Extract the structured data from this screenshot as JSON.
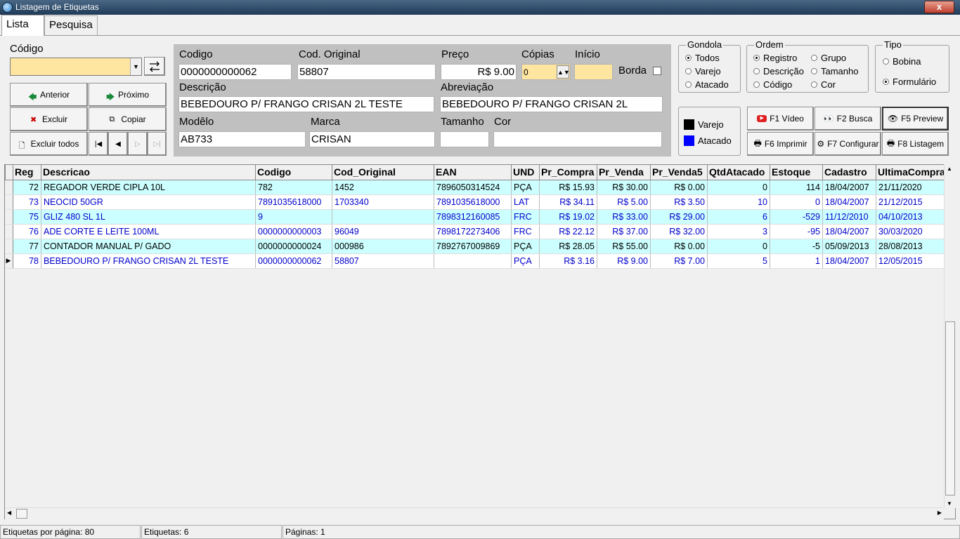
{
  "window": {
    "title": "Listagem de Etiquetas",
    "close": "x"
  },
  "tabs": [
    {
      "label": "Lista"
    },
    {
      "label": "Pesquisa"
    }
  ],
  "left": {
    "codigo_label": "Código",
    "codigo_value": "",
    "anterior": "Anterior",
    "proximo": "Próximo",
    "excluir": "Excluir",
    "copiar": "Copiar",
    "excluir_todos": "Excluir todos"
  },
  "form": {
    "codigo_label": "Codigo",
    "codigo_value": "0000000000062",
    "cod_original_label": "Cod. Original",
    "cod_original_value": "58807",
    "preco_label": "Preço",
    "preco_value": "R$ 9.00",
    "copias_label": "Cópias",
    "copias_value": "0",
    "inicio_label": "Início",
    "inicio_value": "",
    "borda_label": "Borda",
    "descricao_label": "Descrição",
    "descricao_value": "BEBEDOURO P/ FRANGO CRISAN 2L TESTE",
    "abreviacao_label": "Abreviação",
    "abreviacao_value": "BEBEDOURO P/ FRANGO CRISAN 2L",
    "modelo_label": "Modêlo",
    "modelo_value": "AB733",
    "marca_label": "Marca",
    "marca_value": "CRISAN",
    "tamanho_label": "Tamanho",
    "tamanho_value": "",
    "cor_label": "Cor",
    "cor_value": ""
  },
  "gondola": {
    "title": "Gondola",
    "options": [
      "Todos",
      "Varejo",
      "Atacado"
    ],
    "selected": "Todos"
  },
  "ordem": {
    "title": "Ordem",
    "options": [
      "Registro",
      "Grupo",
      "Descrição",
      "Tamanho",
      "Código",
      "Cor"
    ],
    "selected": "Registro"
  },
  "tipo": {
    "title": "Tipo",
    "options": [
      "Bobina",
      "Formulário"
    ],
    "selected": "Formulário"
  },
  "legend": {
    "varejo": "Varejo",
    "atacado": "Atacado",
    "varejo_color": "#000000",
    "atacado_color": "#0000ff"
  },
  "fbuttons": {
    "f1": "F1 Vídeo",
    "f2": "F2 Busca",
    "f5": "F5 Preview",
    "f6": "F6 Imprimir",
    "f7": "F7 Configurar",
    "f8": "F8 Listagem"
  },
  "grid": {
    "columns": [
      "Reg",
      "Descricao",
      "Codigo",
      "Cod_Original",
      "EAN",
      "UND",
      "Pr_Compra",
      "Pr_Venda",
      "Pr_Venda5",
      "QtdAtacado",
      "Estoque",
      "Cadastro",
      "UltimaCompra"
    ],
    "rows": [
      {
        "reg": "72",
        "desc": "REGADOR VERDE CIPLA 10L",
        "cod": "782",
        "orig": "1452",
        "ean": "7896050314524",
        "und": "PÇA",
        "compra": "R$ 15.93",
        "venda": "R$ 30.00",
        "venda5": "R$ 0.00",
        "qtd": "0",
        "estoque": "114",
        "cadastro": "18/04/2007",
        "ultima": "21/11/2020",
        "style": "cyan",
        "color": "#000000",
        "current": false
      },
      {
        "reg": "73",
        "desc": "NEOCID 50GR",
        "cod": "7891035618000",
        "orig": "1703340",
        "ean": "7891035618000",
        "und": "LAT",
        "compra": "R$ 34.11",
        "venda": "R$ 5.00",
        "venda5": "R$ 3.50",
        "qtd": "10",
        "estoque": "0",
        "cadastro": "18/04/2007",
        "ultima": "21/12/2015",
        "style": "white",
        "color": "#0000cc",
        "current": false
      },
      {
        "reg": "75",
        "desc": "GLIZ 480 SL 1L",
        "cod": "9",
        "orig": "",
        "ean": "7898312160085",
        "und": "FRC",
        "compra": "R$ 19.02",
        "venda": "R$ 33.00",
        "venda5": "R$ 29.00",
        "qtd": "6",
        "estoque": "-529",
        "cadastro": "11/12/2010",
        "ultima": "04/10/2013",
        "style": "cyan",
        "color": "#0000cc",
        "current": false
      },
      {
        "reg": "76",
        "desc": "ADE CORTE E LEITE 100ML",
        "cod": "0000000000003",
        "orig": "96049",
        "ean": "7898172273406",
        "und": "FRC",
        "compra": "R$ 22.12",
        "venda": "R$ 37.00",
        "venda5": "R$ 32.00",
        "qtd": "3",
        "estoque": "-95",
        "cadastro": "18/04/2007",
        "ultima": "30/03/2020",
        "style": "white",
        "color": "#0000cc",
        "current": false
      },
      {
        "reg": "77",
        "desc": "CONTADOR MANUAL P/ GADO",
        "cod": "0000000000024",
        "orig": "000986",
        "ean": "7892767009869",
        "und": "PÇA",
        "compra": "R$ 28.05",
        "venda": "R$ 55.00",
        "venda5": "R$ 0.00",
        "qtd": "0",
        "estoque": "-5",
        "cadastro": "05/09/2013",
        "ultima": "28/08/2013",
        "style": "cyan",
        "color": "#000000",
        "current": false
      },
      {
        "reg": "78",
        "desc": "BEBEDOURO P/ FRANGO CRISAN 2L TESTE",
        "cod": "0000000000062",
        "orig": "58807",
        "ean": "",
        "und": "PÇA",
        "compra": "R$ 3.16",
        "venda": "R$ 9.00",
        "venda5": "R$ 7.00",
        "qtd": "5",
        "estoque": "1",
        "cadastro": "18/04/2007",
        "ultima": "12/05/2015",
        "style": "white",
        "color": "#0000cc",
        "current": true
      }
    ]
  },
  "status": {
    "por_pagina": "Etiquetas por página: 80",
    "etiquetas": "Etiquetas: 6",
    "paginas": "Páginas: 1"
  }
}
